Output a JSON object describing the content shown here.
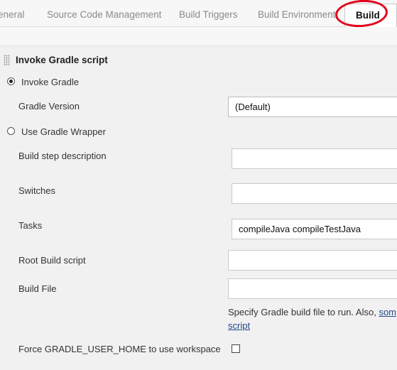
{
  "tabs": {
    "general": "eneral",
    "scm": "Source Code Management",
    "triggers": "Build Triggers",
    "environment": "Build Environment",
    "build": "Build"
  },
  "section": {
    "title": "Invoke Gradle script"
  },
  "form": {
    "invoke_gradle_label": "Invoke Gradle",
    "gradle_version_label": "Gradle Version",
    "gradle_version_value": "(Default)",
    "use_wrapper_label": "Use Gradle Wrapper",
    "description_label": "Build step description",
    "description_value": "",
    "switches_label": "Switches",
    "switches_value": "",
    "tasks_label": "Tasks",
    "tasks_value": "compileJava compileTestJava",
    "root_script_label": "Root Build script",
    "root_script_value": "",
    "build_file_label": "Build File",
    "build_file_value": "",
    "help_text": "Specify Gradle build file to run. Also, ",
    "help_link_part1": "som",
    "help_link_part2": "script",
    "force_home_label": "Force GRADLE_USER_HOME to use workspace"
  },
  "colors": {
    "highlight_ring": "#e3001b",
    "link": "#204a87"
  }
}
